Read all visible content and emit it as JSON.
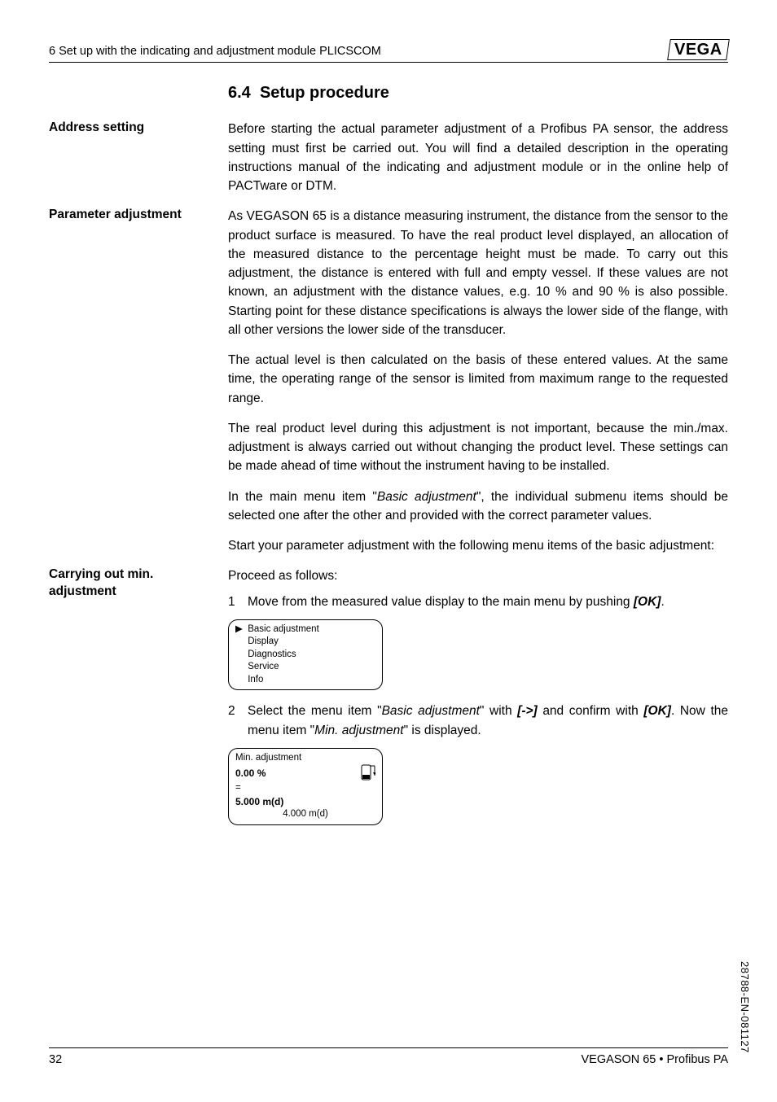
{
  "header": {
    "left": "6  Set up with the indicating and adjustment module PLICSCOM",
    "logo": "VEGA"
  },
  "section": {
    "number": "6.4",
    "title": "Setup procedure"
  },
  "blocks": [
    {
      "label": "Address setting",
      "paras": [
        "Before starting the actual parameter adjustment of a Profibus PA sensor, the address setting must first be carried out. You will find a detailed description in the operating instructions manual of the indicating and adjustment module or in the online help of PACTware or DTM."
      ]
    },
    {
      "label": "Parameter adjustment",
      "paras": [
        "As VEGASON 65 is a distance measuring instrument, the distance from the sensor to the product surface is measured. To have the real product level displayed, an allocation of the measured distance to the percentage height must be made. To carry out this adjustment, the distance is entered with full and empty vessel. If these values are not known, an adjustment with the distance values, e.g. 10 % and 90 % is also possible. Starting point for these distance specifications is always the lower side of the flange, with all other versions the lower side of the transducer.",
        "The actual level is then calculated on the basis of these entered values. At the same time, the operating range of the sensor is limited from maximum range to the requested range.",
        "The real product level during this adjustment is not important, because the min./max. adjustment is always carried out without changing the product level. These settings can be made ahead of time without the instrument having to be installed."
      ],
      "rich": [
        {
          "type": "para",
          "runs": [
            {
              "t": "In the main menu item \""
            },
            {
              "t": "Basic adjustment",
              "i": true
            },
            {
              "t": "\", the individual submenu items should be selected one after the other and provided with the correct parameter values."
            }
          ]
        },
        {
          "type": "para",
          "runs": [
            {
              "t": "Start your parameter adjustment with the following menu items of the basic adjustment:"
            }
          ]
        }
      ]
    },
    {
      "label": "Carrying out min. adjustment",
      "intro": "Proceed as follows:",
      "steps": [
        {
          "n": "1",
          "runs": [
            {
              "t": "Move from the measured value display to the main menu by pushing "
            },
            {
              "t": "[OK]",
              "b": true
            },
            {
              "t": "."
            }
          ]
        },
        {
          "n": "2",
          "runs": [
            {
              "t": "Select the menu item \""
            },
            {
              "t": "Basic adjustment",
              "i": true
            },
            {
              "t": "\" with "
            },
            {
              "t": "[->]",
              "b": true
            },
            {
              "t": " and confirm with "
            },
            {
              "t": "[OK]",
              "b": true
            },
            {
              "t": ". Now the menu item \""
            },
            {
              "t": "Min. adjustment",
              "i": true
            },
            {
              "t": "\" is displayed."
            }
          ]
        }
      ]
    }
  ],
  "menuBox": {
    "items": [
      "Basic adjustment",
      "Display",
      "Diagnostics",
      "Service",
      "Info"
    ],
    "selected": 0
  },
  "lcdBox": {
    "line1": "Min. adjustment",
    "pct": "0.00 %",
    "eq": "=",
    "val": "5.000 m(d)",
    "foot": "4.000 m(d)"
  },
  "footer": {
    "page": "32",
    "right": "VEGASON 65 • Profibus PA"
  },
  "sideCode": "28788-EN-081127"
}
